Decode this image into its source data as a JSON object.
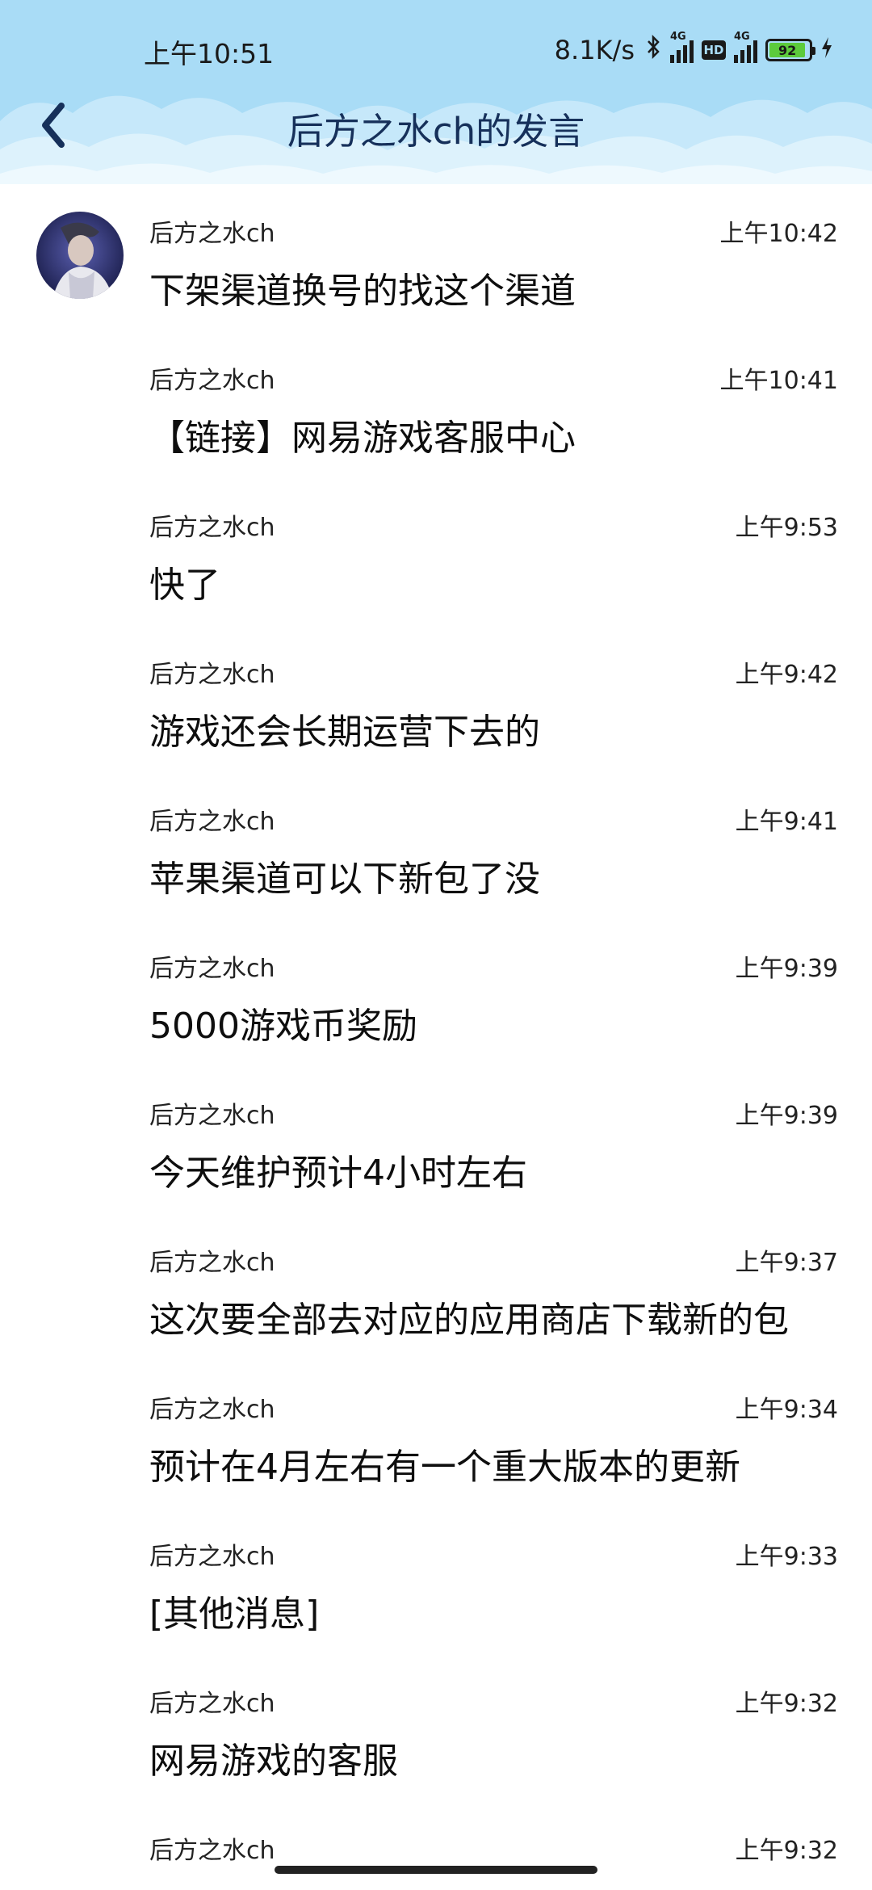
{
  "status_bar": {
    "time": "上午10:51",
    "net_speed": "8.1K/s",
    "signal1_tag": "4G",
    "signal2_tag": "4G",
    "hd_badge": "HD",
    "battery": "92",
    "battery_level_percent": 92,
    "icons": [
      "bluetooth-icon",
      "signal-icon",
      "hd-icon",
      "signal-icon",
      "battery-icon",
      "charging-icon"
    ]
  },
  "header": {
    "title": "后方之水ch的发言",
    "back_icon": "chevron-left-icon"
  },
  "colors": {
    "header_bg": "#a9dcf6",
    "title_text": "#16305a",
    "battery_fill": "#5ccb3c"
  },
  "messages": [
    {
      "sender": "后方之水ch",
      "time": "上午10:42",
      "text": "下架渠道换号的找这个渠道"
    },
    {
      "sender": "后方之水ch",
      "time": "上午10:41",
      "text": "【链接】网易游戏客服中心"
    },
    {
      "sender": "后方之水ch",
      "time": "上午9:53",
      "text": "快了"
    },
    {
      "sender": "后方之水ch",
      "time": "上午9:42",
      "text": "游戏还会长期运营下去的"
    },
    {
      "sender": "后方之水ch",
      "time": "上午9:41",
      "text": "苹果渠道可以下新包了没"
    },
    {
      "sender": "后方之水ch",
      "time": "上午9:39",
      "text": "5000游戏币奖励"
    },
    {
      "sender": "后方之水ch",
      "time": "上午9:39",
      "text": "今天维护预计4小时左右"
    },
    {
      "sender": "后方之水ch",
      "time": "上午9:37",
      "text": "这次要全部去对应的应用商店下载新的包"
    },
    {
      "sender": "后方之水ch",
      "time": "上午9:34",
      "text": "预计在4月左右有一个重大版本的更新"
    },
    {
      "sender": "后方之水ch",
      "time": "上午9:33",
      "text": "[其他消息]"
    },
    {
      "sender": "后方之水ch",
      "time": "上午9:32",
      "text": "网易游戏的客服"
    },
    {
      "sender": "后方之水ch",
      "time": "上午9:32",
      "text": ""
    }
  ]
}
